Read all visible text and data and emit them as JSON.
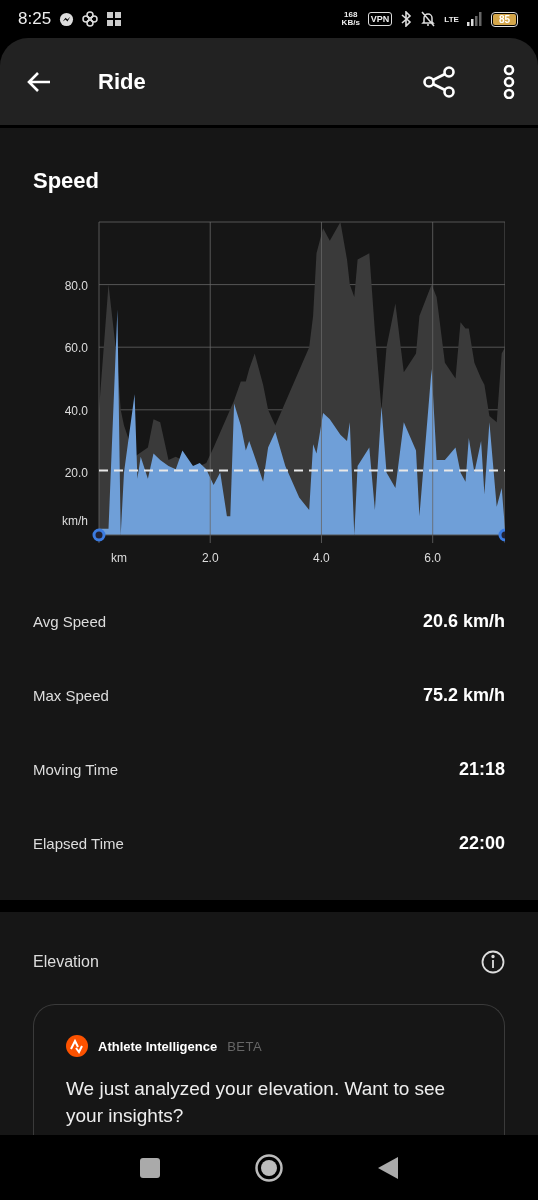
{
  "status_bar": {
    "time": "8:25",
    "network_speed": {
      "value": "168",
      "unit": "KB/s"
    },
    "vpn": "VPN",
    "network": "LTE",
    "battery": "85"
  },
  "app_bar": {
    "title": "Ride"
  },
  "speed": {
    "title": "Speed",
    "chart": {
      "chart_data": {
        "type": "area",
        "xlabel": "km",
        "ylabel": "km/h",
        "xlim": [
          0,
          7.3
        ],
        "ylim": [
          0,
          100
        ],
        "grid": true,
        "xticks": [
          {
            "value": 2,
            "label": "2.0"
          },
          {
            "value": 4,
            "label": "4.0"
          },
          {
            "value": 6,
            "label": "6.0"
          }
        ],
        "yticks": [
          {
            "value": 20,
            "label": "20.0"
          },
          {
            "value": 40,
            "label": "40.0"
          },
          {
            "value": 60,
            "label": "60.0"
          },
          {
            "value": 80,
            "label": "80.0"
          }
        ],
        "x": [
          0,
          0.17,
          0.33,
          0.39,
          0.45,
          0.64,
          0.69,
          0.75,
          0.88,
          0.98,
          1.1,
          1.25,
          1.38,
          1.5,
          1.69,
          1.81,
          1.93,
          2.06,
          2.18,
          2.3,
          2.36,
          2.43,
          2.55,
          2.64,
          2.7,
          2.8,
          2.95,
          3.04,
          3.17,
          3.35,
          3.6,
          3.78,
          3.85,
          3.91,
          4.03,
          4.15,
          4.34,
          4.46,
          4.51,
          4.59,
          4.65,
          4.86,
          4.96,
          5.08,
          5.17,
          5.33,
          5.48,
          5.7,
          5.76,
          5.98,
          6.07,
          6.22,
          6.41,
          6.5,
          6.59,
          6.65,
          6.75,
          6.87,
          6.93,
          7.02,
          7.15,
          7.24,
          7.3
        ],
        "series": [
          {
            "color": "#3a3a3a",
            "values": [
              40,
              80,
              55,
              40,
              35,
              25,
              null,
              null,
              28,
              37,
              36,
              24,
              25,
              null,
              22,
              22,
              23,
              28,
              null,
              null,
              null,
              43,
              49,
              49,
              53,
              58,
              48,
              40,
              35,
              null,
              null,
              60,
              70,
              90,
              98,
              94,
              100,
              88,
              80,
              76,
              88,
              90,
              65,
              40,
              60,
              74,
              52,
              58,
              70,
              80,
              76,
              55,
              50,
              68,
              66,
              66,
              55,
              50,
              48,
              38,
              36,
              58,
              60
            ]
          },
          {
            "color": "#6f9fd8",
            "values": [
              2,
              2,
              72,
              0,
              20,
              45,
              18,
              25,
              18,
              26,
              24,
              22,
              21,
              27,
              22,
              23,
              21,
              16,
              20,
              6,
              6,
              42,
              35,
              27,
              30,
              25,
              17,
              28,
              33,
              22,
              12,
              8,
              29,
              26,
              39,
              37,
              32,
              30,
              36,
              0,
              22,
              28,
              8,
              41,
              20,
              15,
              36,
              27,
              6,
              53,
              24,
              24,
              28,
              20,
              17,
              31,
              20,
              30,
              13,
              36,
              9,
              15,
              2
            ]
          }
        ],
        "ref_lines": [
          {
            "axis": "y",
            "value": 20.6
          }
        ]
      }
    },
    "stats": [
      {
        "label": "Avg Speed",
        "value": "20.6 km/h"
      },
      {
        "label": "Max Speed",
        "value": "75.2 km/h"
      },
      {
        "label": "Moving Time",
        "value": "21:18"
      },
      {
        "label": "Elapsed Time",
        "value": "22:00"
      }
    ]
  },
  "elevation": {
    "title": "Elevation",
    "card": {
      "title": "Athlete Intelligence",
      "badge": "BETA",
      "text": "We just analyzed your elevation. Want to see your insights?"
    }
  }
}
